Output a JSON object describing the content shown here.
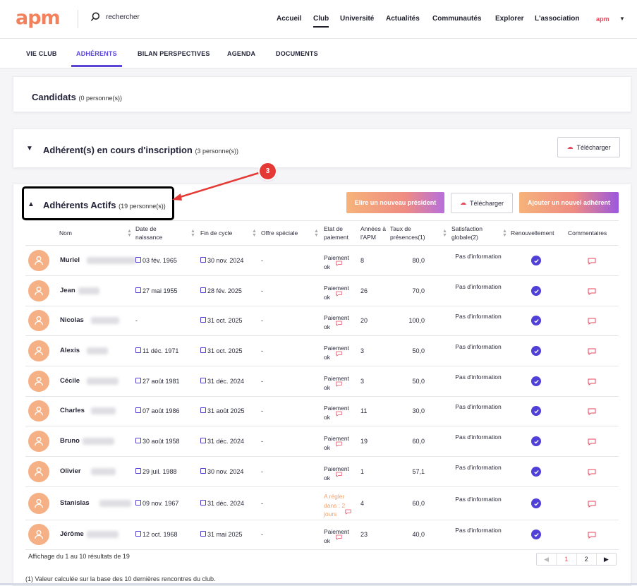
{
  "brand": {
    "logo": "apm",
    "mini_logo": "apm"
  },
  "search": {
    "placeholder": "rechercher"
  },
  "topnav": [
    "Accueil",
    "Club",
    "Université",
    "Actualités",
    "Communautés",
    "Explorer",
    "L'association"
  ],
  "tabs": [
    "VIE CLUB",
    "ADHÉRENTS",
    "BILAN PERSPECTIVES",
    "AGENDA",
    "DOCUMENTS"
  ],
  "candidats": {
    "title": "Candidats",
    "count": "(0 personne(s))"
  },
  "inscription": {
    "title": "Adhérent(s) en cours d'inscription",
    "count": "(3 personne(s))",
    "download": "Télécharger"
  },
  "actifs": {
    "title": "Adhérents Actifs",
    "count": "(19 personne(s))",
    "btn_president": "Elire un nouveau président",
    "btn_download": "Télécharger",
    "btn_add": "Ajouter un nouvel adhérent"
  },
  "annotation": {
    "step": "3"
  },
  "table": {
    "headers": [
      "Nom",
      "Date de naissance",
      "Fin de cycle",
      "Offre spéciale",
      "Etat de paiement",
      "Années à l'APM",
      "Taux de présences(1)",
      "Satisfaction globale(2)",
      "Renouvellement",
      "Commentaires"
    ],
    "rows": [
      {
        "name": "Muriel",
        "birth": "03 fév. 1965",
        "cycle": "30 nov. 2024",
        "offer": "-",
        "pay": "Paiement ok",
        "years": "8",
        "rate": "80,0",
        "sat": "Pas d'information"
      },
      {
        "name": "Jean",
        "birth": "27 mai 1955",
        "cycle": "28 fév. 2025",
        "offer": "-",
        "pay": "Paiement ok",
        "years": "26",
        "rate": "70,0",
        "sat": "Pas d'information"
      },
      {
        "name": "Nicolas",
        "birth": "-",
        "cycle": "31 oct. 2025",
        "offer": "-",
        "pay": "Paiement ok",
        "years": "20",
        "rate": "100,0",
        "sat": "Pas d'information"
      },
      {
        "name": "Alexis",
        "birth": "11 déc. 1971",
        "cycle": "31 oct. 2025",
        "offer": "-",
        "pay": "Paiement ok",
        "years": "3",
        "rate": "50,0",
        "sat": "Pas d'information"
      },
      {
        "name": "Cécile",
        "birth": "27 août 1981",
        "cycle": "31 déc. 2024",
        "offer": "-",
        "pay": "Paiement ok",
        "years": "3",
        "rate": "50,0",
        "sat": "Pas d'information"
      },
      {
        "name": "Charles",
        "birth": "07 août 1986",
        "cycle": "31 août 2025",
        "offer": "-",
        "pay": "Paiement ok",
        "years": "11",
        "rate": "30,0",
        "sat": "Pas d'information"
      },
      {
        "name": "Bruno",
        "birth": "30 août 1958",
        "cycle": "31 déc. 2024",
        "offer": "-",
        "pay": "Paiement ok",
        "years": "19",
        "rate": "60,0",
        "sat": "Pas d'information"
      },
      {
        "name": "Olivier",
        "birth": "29 juil. 1988",
        "cycle": "30 nov. 2024",
        "offer": "-",
        "pay": "Paiement ok",
        "years": "1",
        "rate": "57,1",
        "sat": "Pas d'information"
      },
      {
        "name": "Stanislas",
        "birth": "09 nov. 1967",
        "cycle": "31 déc. 2024",
        "offer": "-",
        "pay": "A régler dans : 2 jours",
        "years": "4",
        "rate": "60,0",
        "sat": "Pas d'information"
      },
      {
        "name": "Jérôme",
        "birth": "12 oct. 1968",
        "cycle": "31 mai 2025",
        "offer": "-",
        "pay": "Paiement ok",
        "years": "23",
        "rate": "40,0",
        "sat": "Pas d'information"
      }
    ]
  },
  "footer": {
    "results": "Affichage du 1 au 10 résultats de 19",
    "note": "(1) Valeur calculée sur la base des 10 dernières rencontres du club."
  },
  "pagination": {
    "prev": "◀",
    "p1": "1",
    "p2": "2",
    "next": "▶"
  },
  "colors": {
    "accent": "#5b45d9",
    "brand": "#ef4f6a",
    "avatar": "#f6b085",
    "warning": "#f1a06e"
  },
  "icons": [
    "search-icon",
    "chevron-down-icon",
    "chevron-up-icon",
    "cloud-download-icon",
    "user-icon",
    "calendar-icon",
    "comment-icon",
    "check-circle-icon"
  ]
}
